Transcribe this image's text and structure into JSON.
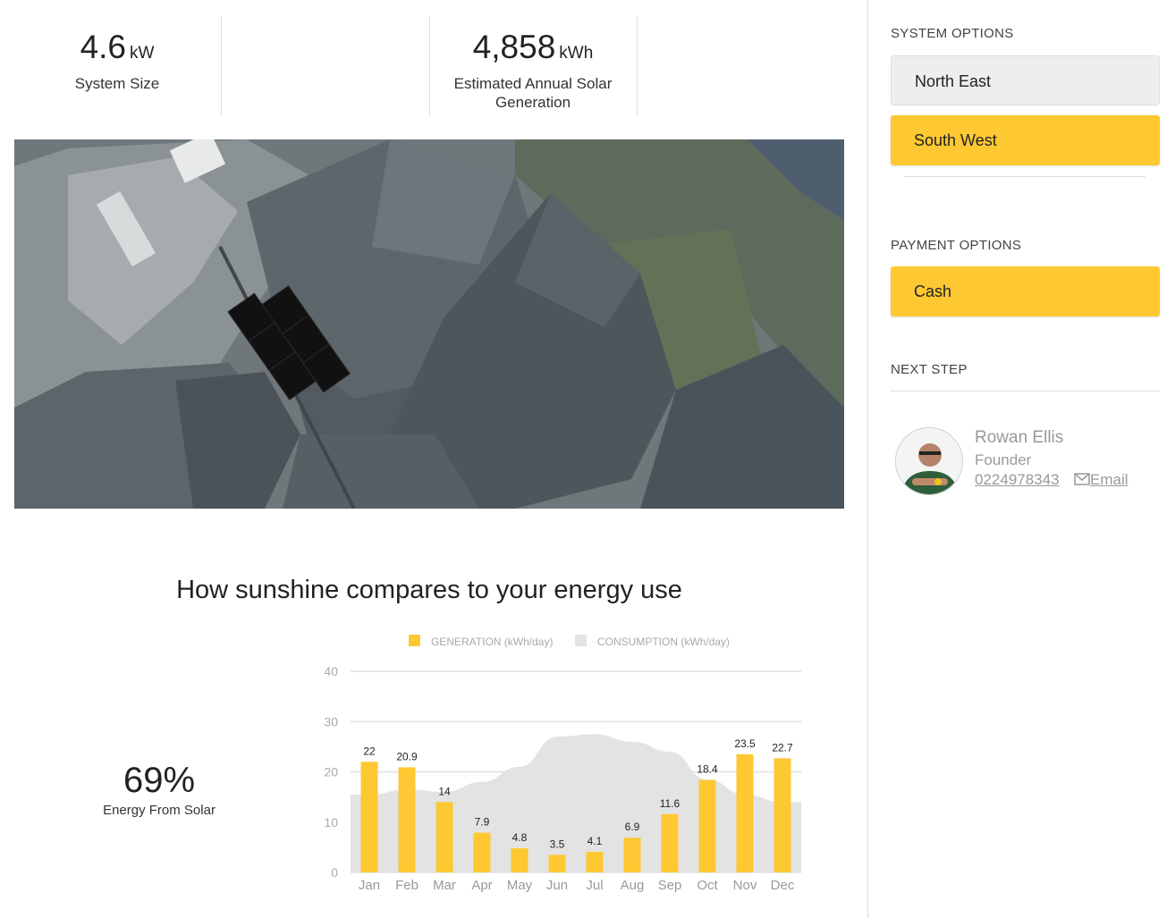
{
  "stats": {
    "system_size": {
      "value": "4.6",
      "unit": "kW",
      "label": "System Size"
    },
    "annual_generation": {
      "value": "4,858",
      "unit": "kWh",
      "label_line1": "Estimated Annual Solar",
      "label_line2": "Generation"
    }
  },
  "map": {
    "icon": "aerial-roof-image",
    "panel_color": "#111111"
  },
  "chart_section": {
    "title": "How sunshine compares to your energy use",
    "solar_percent": "69%",
    "solar_percent_label": "Energy From Solar"
  },
  "chart_data": {
    "type": "bar",
    "categories": [
      "Jan",
      "Feb",
      "Mar",
      "Apr",
      "May",
      "Jun",
      "Jul",
      "Aug",
      "Sep",
      "Oct",
      "Nov",
      "Dec"
    ],
    "series": [
      {
        "name": "GENERATION (kWh/day)",
        "kind": "bar",
        "color": "#fec833",
        "values": [
          22,
          20.9,
          14,
          7.9,
          4.8,
          3.5,
          4.1,
          6.9,
          11.6,
          18.4,
          23.5,
          22.7
        ]
      },
      {
        "name": "CONSUMPTION (kWh/day)",
        "kind": "area",
        "color": "#e3e3e3",
        "values": [
          15.5,
          16.5,
          16,
          18,
          21,
          27,
          27.5,
          26,
          24,
          18.5,
          15.5,
          14
        ]
      }
    ],
    "yticks": [
      "0",
      "10",
      "20",
      "30",
      "40"
    ],
    "ylim": [
      0,
      40
    ],
    "grid": true,
    "legend": "top"
  },
  "sidebar": {
    "system_options_title": "SYSTEM OPTIONS",
    "system_options": [
      "North East",
      "South West"
    ],
    "payment_options_title": "PAYMENT OPTIONS",
    "payment_options": [
      "Cash"
    ],
    "next_step_title": "NEXT STEP",
    "contact": {
      "name": "Rowan Ellis",
      "role": "Founder",
      "phone": "0224978343",
      "email_label": "Email",
      "email_icon": "envelope-icon",
      "avatar_icon": "person-avatar"
    }
  },
  "colors": {
    "accent": "#fec833",
    "selected_option": "#eeeeee"
  }
}
